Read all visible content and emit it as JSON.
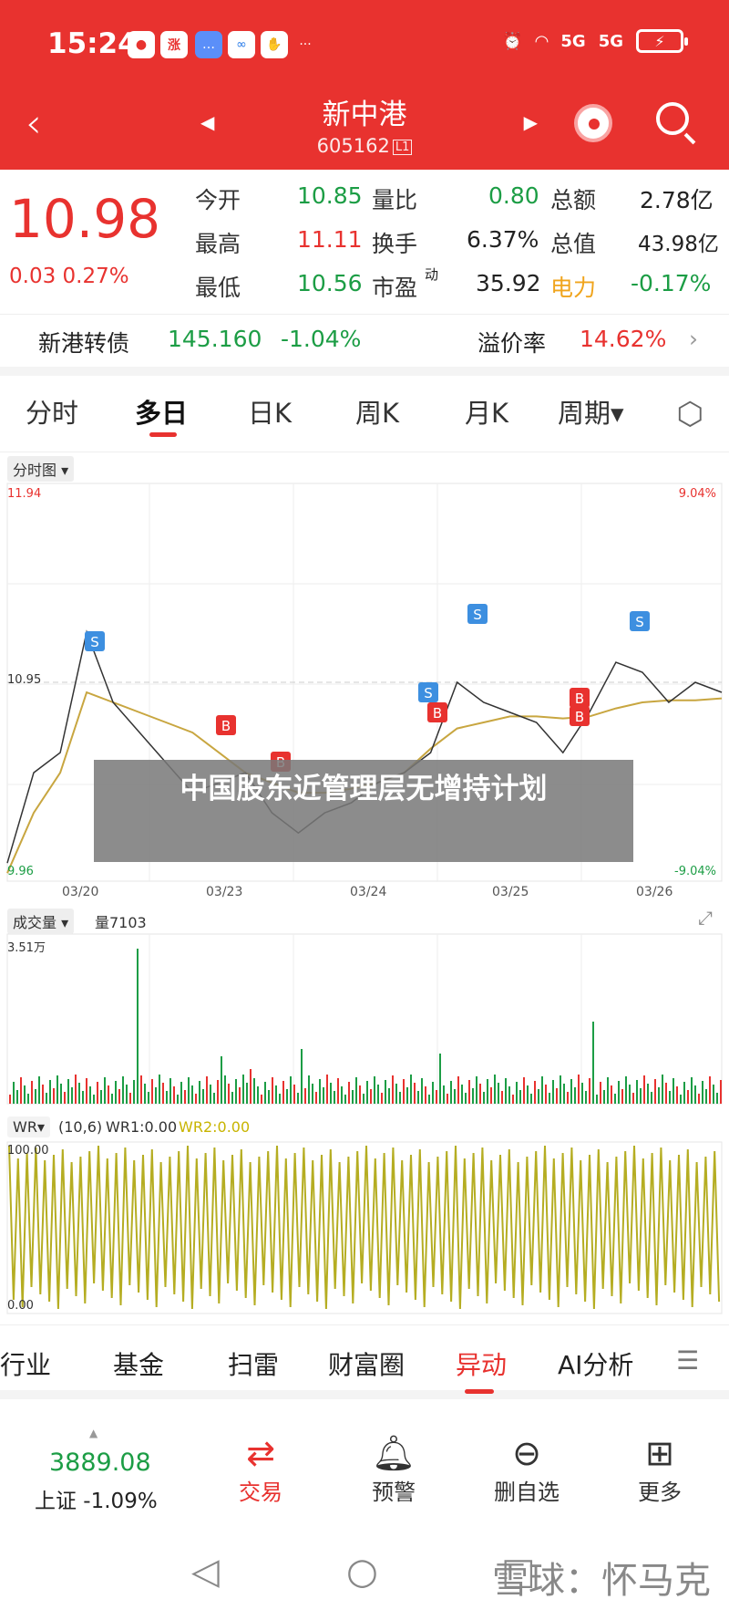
{
  "status": {
    "time": "15:24",
    "app_badge": "涨",
    "network1": "5G",
    "network2": "5G"
  },
  "header": {
    "name": "新中港",
    "code": "605162",
    "market_tag": "L1"
  },
  "quote": {
    "price": "10.98",
    "change": "0.03 0.27%",
    "rows": [
      [
        {
          "label": "今开",
          "value": "10.85",
          "color": "green"
        },
        {
          "label": "量比",
          "value": "0.80",
          "color": "green"
        },
        {
          "label": "总额",
          "value": "2.78亿",
          "color": "dark"
        }
      ],
      [
        {
          "label": "最高",
          "value": "11.11",
          "color": "red"
        },
        {
          "label": "换手",
          "value": "6.37%",
          "color": "dark"
        },
        {
          "label": "总值",
          "value": "43.98亿",
          "color": "dark"
        }
      ],
      [
        {
          "label": "最低",
          "value": "10.56",
          "color": "green"
        },
        {
          "label": "市盈",
          "value": "35.92",
          "color": "dark"
        },
        {
          "label": "电力",
          "value": "-0.17%",
          "color": "green"
        }
      ]
    ],
    "pe_sup": "动"
  },
  "bond": {
    "label": "新港转债",
    "price": "145.160",
    "change": "-1.04%",
    "premium_label": "溢价率",
    "premium_value": "14.62%"
  },
  "tabs": [
    "分时",
    "多日",
    "日K",
    "周K",
    "月K",
    "周期▾"
  ],
  "chart": {
    "tag_price": "分时图",
    "tag_volume": "成交量",
    "volume_value": "量7103",
    "tag_wr": "WR",
    "wr_params": "(10,6)",
    "wr1": "WR1:0.00",
    "wr2": "WR2:0.00",
    "high_label": "11.94",
    "high_pct": "9.04%",
    "mid_label": "10.95",
    "low_label": "9.96",
    "low_pct": "-9.04%",
    "vol_max": "3.51万",
    "wr_max": "100.00",
    "wr_min": "0.00",
    "dates": [
      "03/20",
      "03/23",
      "03/24",
      "03/25",
      "03/26"
    ],
    "overlay_title": "中国股东近管理层无增持计划"
  },
  "chart_data": {
    "type": "line",
    "title": "分时图",
    "categories": [
      "03/20",
      "03/23",
      "03/24",
      "03/25",
      "03/26"
    ],
    "ylim": [
      9.96,
      11.94
    ],
    "reference": 10.95,
    "series": [
      {
        "name": "price",
        "values": [
          10.05,
          10.5,
          10.6,
          11.2,
          10.85,
          10.7,
          10.55,
          10.4,
          10.45,
          10.5,
          10.3,
          10.2,
          10.3,
          10.35,
          10.45,
          10.5,
          10.6,
          10.95,
          10.85,
          10.8,
          10.75,
          10.6,
          10.8,
          11.05,
          11.0,
          10.85,
          10.95,
          10.9
        ]
      },
      {
        "name": "avg",
        "values": [
          10.0,
          10.3,
          10.5,
          10.9,
          10.85,
          10.8,
          10.75,
          10.7,
          10.6,
          10.5,
          10.45,
          10.4,
          10.4,
          10.42,
          10.45,
          10.5,
          10.62,
          10.72,
          10.75,
          10.78,
          10.78,
          10.77,
          10.78,
          10.82,
          10.85,
          10.86,
          10.86,
          10.87
        ]
      }
    ],
    "signals": [
      "S",
      "B",
      "B",
      "S",
      "B",
      "S",
      "B",
      "B",
      "S"
    ]
  },
  "bottom_tabs": [
    "行业",
    "基金",
    "扫雷",
    "财富圈",
    "异动",
    "AI分析"
  ],
  "dock": {
    "index_value": "3889.08",
    "index_label": "上证 -1.09%",
    "items": [
      "交易",
      "预警",
      "删自选",
      "更多"
    ]
  },
  "watermark": "雪球：怀马克"
}
